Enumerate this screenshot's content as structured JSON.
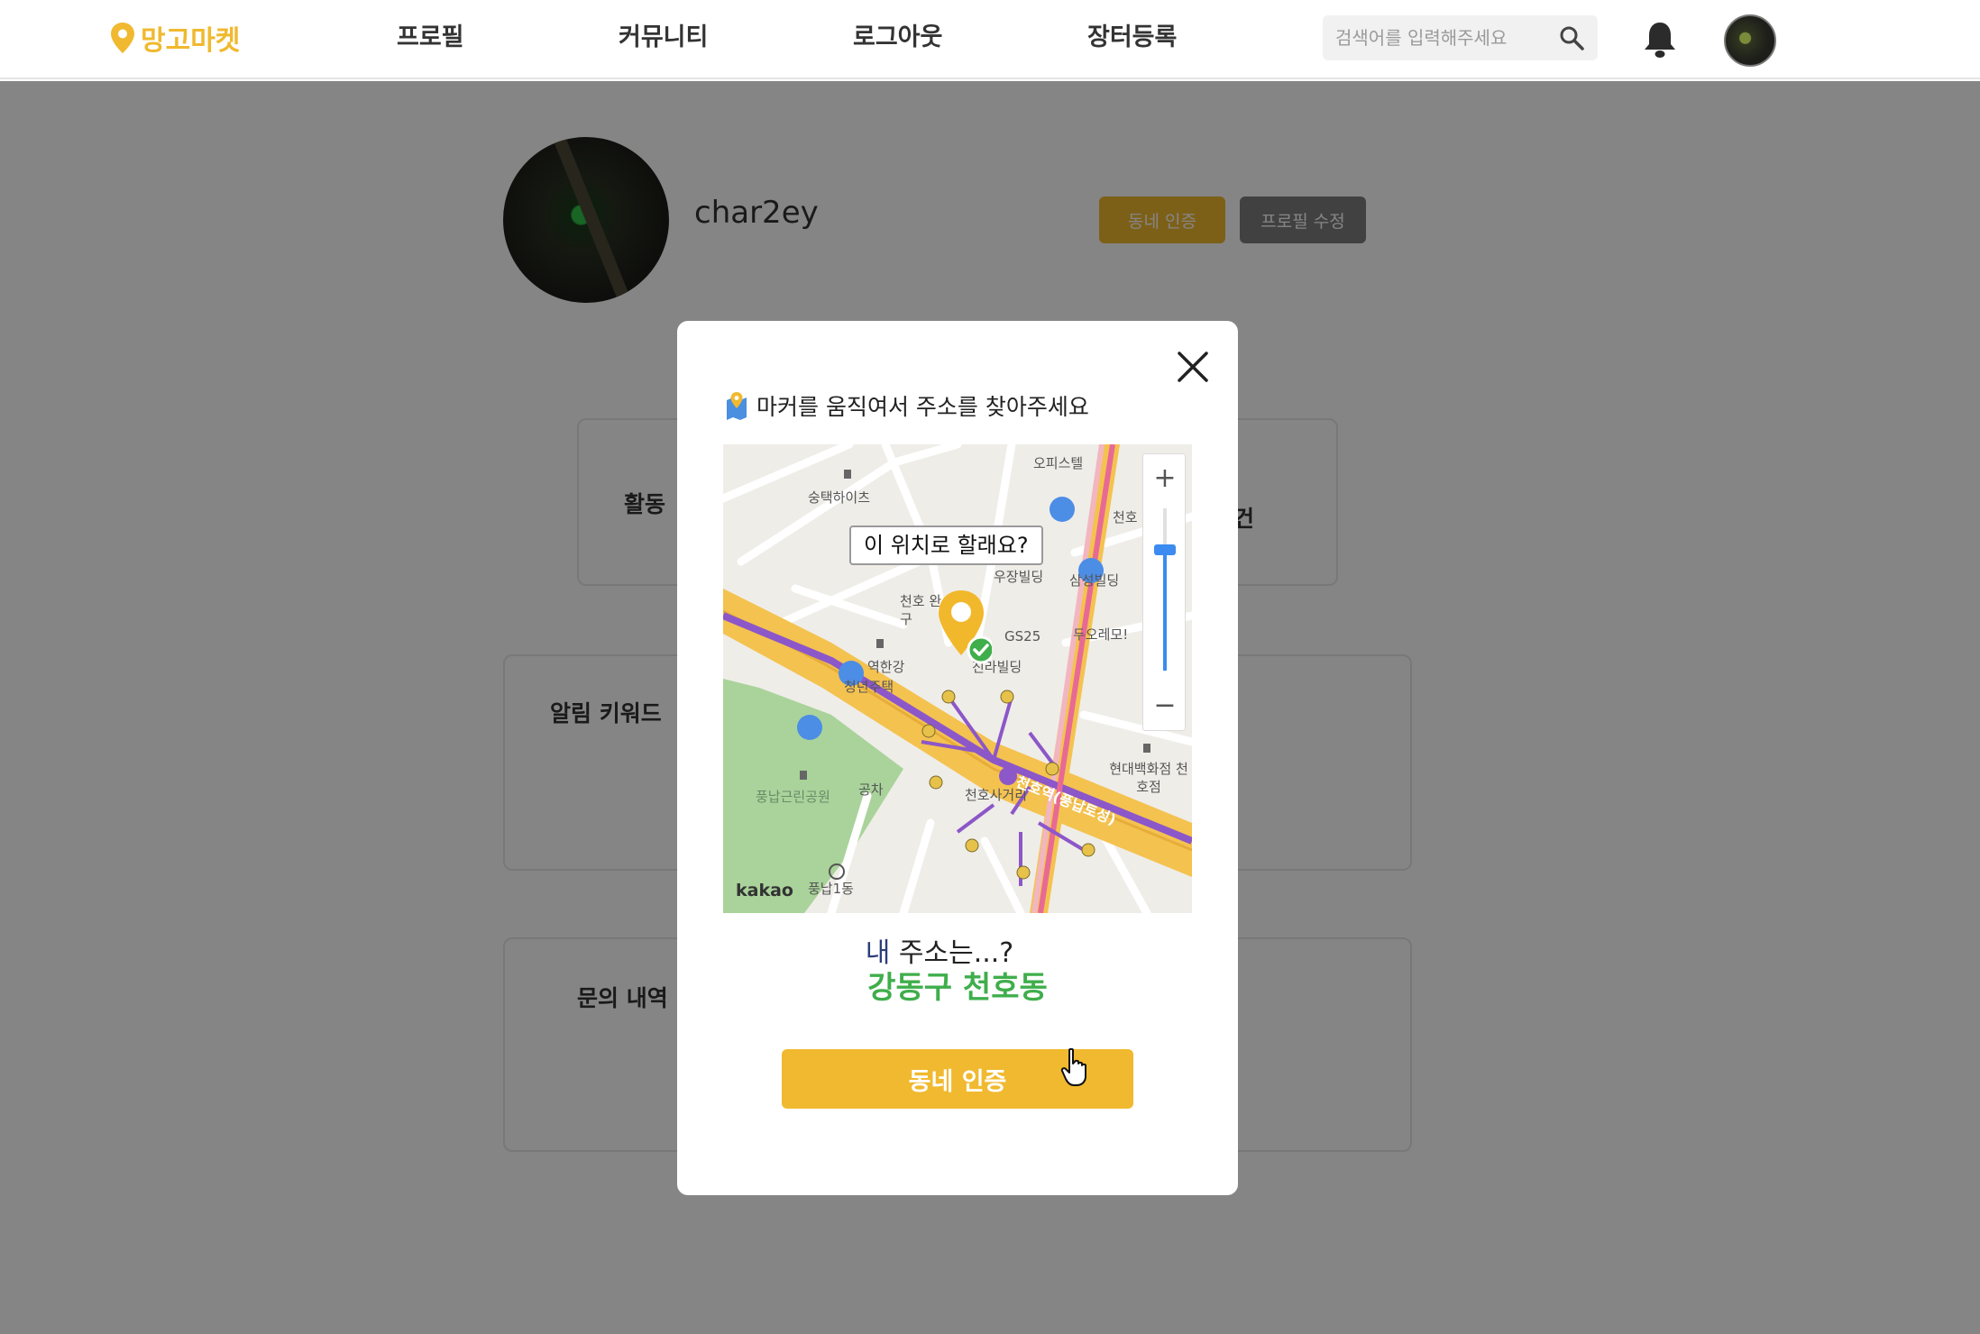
{
  "header": {
    "logo_text": "망고마켓",
    "nav": [
      "프로필",
      "커뮤니티",
      "로그아웃",
      "장터등록"
    ],
    "search_placeholder": "검색어를 입력해주세요",
    "icons": {
      "logo": "map-pin-icon",
      "search": "search-icon",
      "notifications": "bell-icon",
      "avatar": "avatar"
    }
  },
  "profile": {
    "username": "char2ey",
    "verify_button": "동네 인증",
    "edit_button": "프로필 수정"
  },
  "sections": [
    {
      "title": "활동"
    },
    {
      "title": "알림 키워드"
    },
    {
      "title": "문의 내역"
    }
  ],
  "modal": {
    "heading": "마커를 움직여서 주소를 찾아주세요",
    "tooltip": "이 위치로 할래요?",
    "map": {
      "labels": [
        "숭택하이츠",
        "천호",
        "우장빌딩",
        "삼성빌딩",
        "GS25",
        "두오레모!",
        "천호 완구",
        "역한강",
        "청년주택",
        "진라빌딩",
        "현대백화점 천호점",
        "풍납근린공원",
        "공차",
        "풍납1동",
        "천호역(풍납토성)",
        "오피스텔",
        "천호사거리"
      ],
      "attribution": "kakao",
      "zoom_in": "+",
      "zoom_out": "−"
    },
    "address_question_prefix": "내",
    "address_question_rest": " 주소는...?",
    "address_value": "강동구 천호동",
    "verify_button": "동네 인증"
  },
  "colors": {
    "accent": "#f0b92f",
    "address_green": "#3fae4b",
    "overlay": "rgba(0,0,0,0.48)"
  }
}
